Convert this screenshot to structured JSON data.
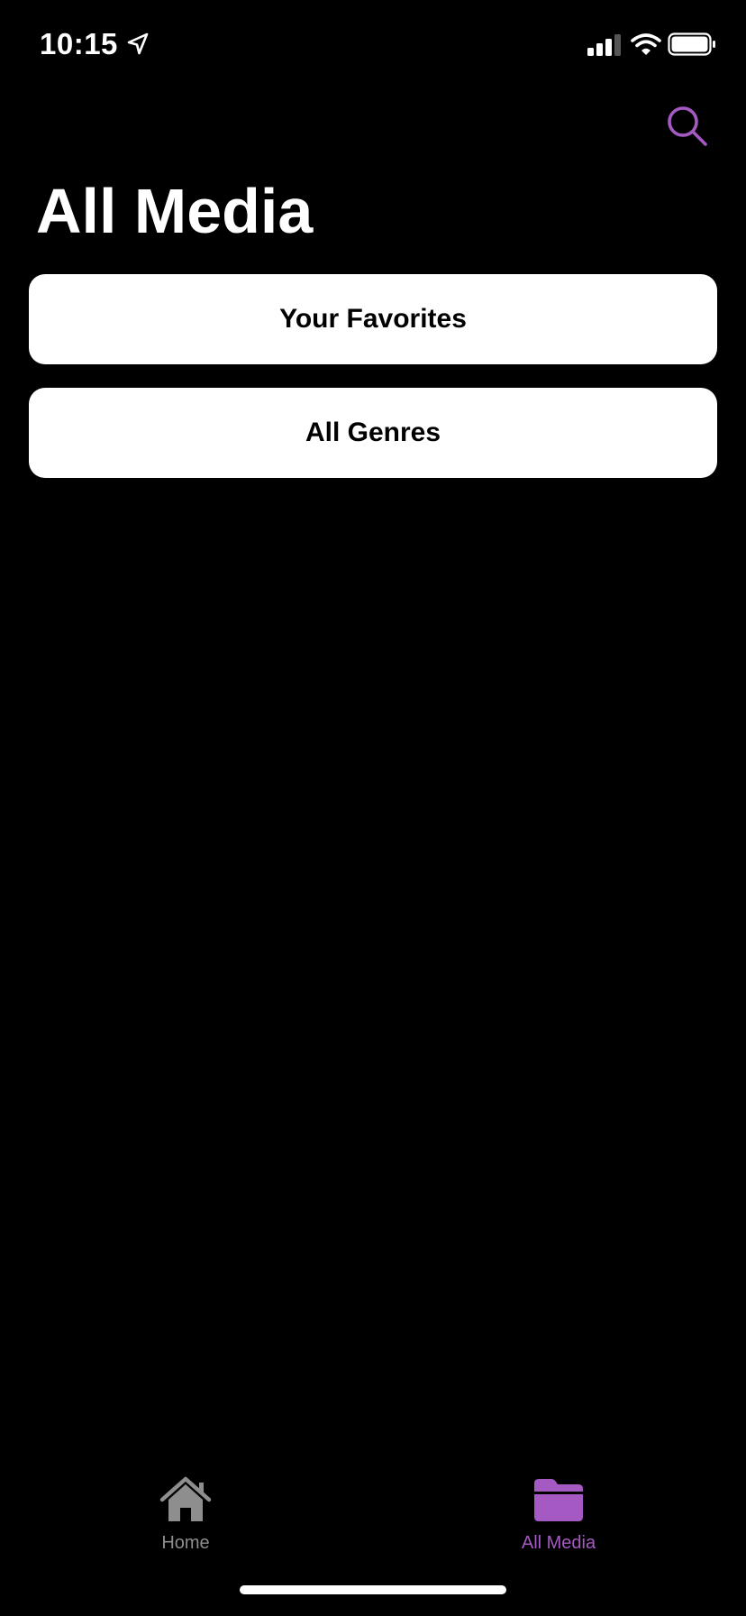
{
  "status_bar": {
    "time": "10:15",
    "icons": [
      "location-arrow-icon",
      "cellular-signal-icon",
      "wifi-icon",
      "battery-icon"
    ]
  },
  "header": {
    "search_icon": "magnifier-icon",
    "title": "All Media"
  },
  "cards": [
    {
      "label": "Your Favorites"
    },
    {
      "label": "All Genres"
    }
  ],
  "tab_bar": {
    "items": [
      {
        "label": "Home",
        "icon": "house-icon",
        "selected": false
      },
      {
        "label": "All Media",
        "icon": "folder-icon",
        "selected": true
      }
    ]
  },
  "colors": {
    "accent": "#a45ac2",
    "inactive": "#8e8e8e",
    "background": "#000000",
    "card": "#ffffff"
  }
}
